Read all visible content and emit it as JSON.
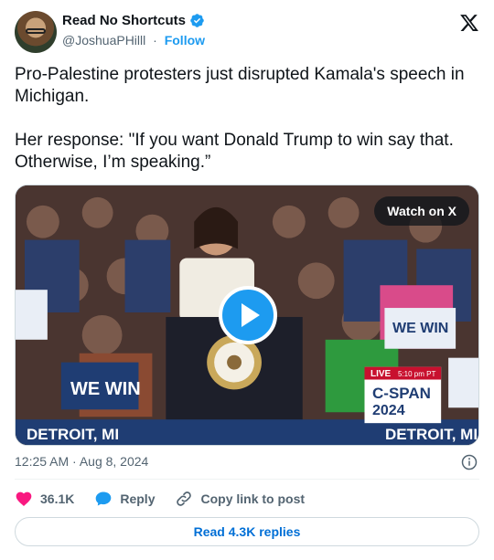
{
  "header": {
    "display_name": "Read No Shortcuts",
    "handle": "@JoshuaPHilll",
    "separator": "·",
    "follow_label": "Follow"
  },
  "tweet": {
    "text": "Pro-Palestine protesters just disrupted Kamala's speech in Michigan.\n\nHer response: \"If you want Donald Trump to win say that. Otherwise, I’m speaking.”"
  },
  "media": {
    "watch_label": "Watch on X",
    "sign_text_left": "WE WIN",
    "sign_text_center": "WE WIN",
    "banner_left": "DETROIT, MI",
    "banner_right": "DETROIT, MI",
    "cspan_live": "LIVE",
    "cspan_time": "5:10 pm PT",
    "cspan_name": "C-SPAN",
    "cspan_year": "2024"
  },
  "meta": {
    "timestamp": "12:25 AM · Aug 8, 2024"
  },
  "actions": {
    "like_count": "36.1K",
    "reply_label": "Reply",
    "copy_label": "Copy link to post"
  },
  "footer": {
    "read_replies": "Read 4.3K replies"
  },
  "colors": {
    "accent": "#1d9bf0",
    "link": "#006fd6",
    "like": "#f91880",
    "muted": "#536471"
  }
}
